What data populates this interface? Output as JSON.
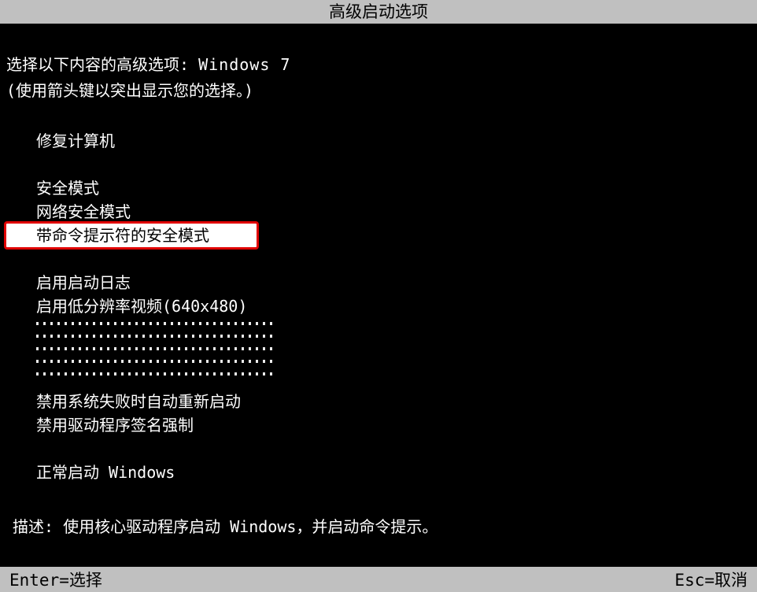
{
  "title": "高级启动选项",
  "prompt": {
    "prefix": "选择以下内容的高级选项: ",
    "os": "Windows 7"
  },
  "instruction": "(使用箭头键以突出显示您的选择。)",
  "menu": {
    "groups": [
      [
        {
          "label": "修复计算机",
          "selected": false
        }
      ],
      [
        {
          "label": "安全模式",
          "selected": false
        },
        {
          "label": "网络安全模式",
          "selected": false
        },
        {
          "label": "带命令提示符的安全模式",
          "selected": true
        }
      ],
      [
        {
          "label": "启用启动日志",
          "selected": false
        },
        {
          "label": "启用低分辨率视频(640x480)",
          "selected": false
        },
        {
          "garbled": true
        },
        {
          "label": "禁用系统失败时自动重新启动",
          "selected": false
        },
        {
          "label": "禁用驱动程序签名强制",
          "selected": false
        }
      ],
      [
        {
          "label": "正常启动 Windows",
          "selected": false
        }
      ]
    ]
  },
  "description": {
    "label": "描述: ",
    "text": "使用核心驱动程序启动 Windows，并启动命令提示。"
  },
  "footer": {
    "enter": "Enter=选择",
    "esc": "Esc=取消"
  }
}
